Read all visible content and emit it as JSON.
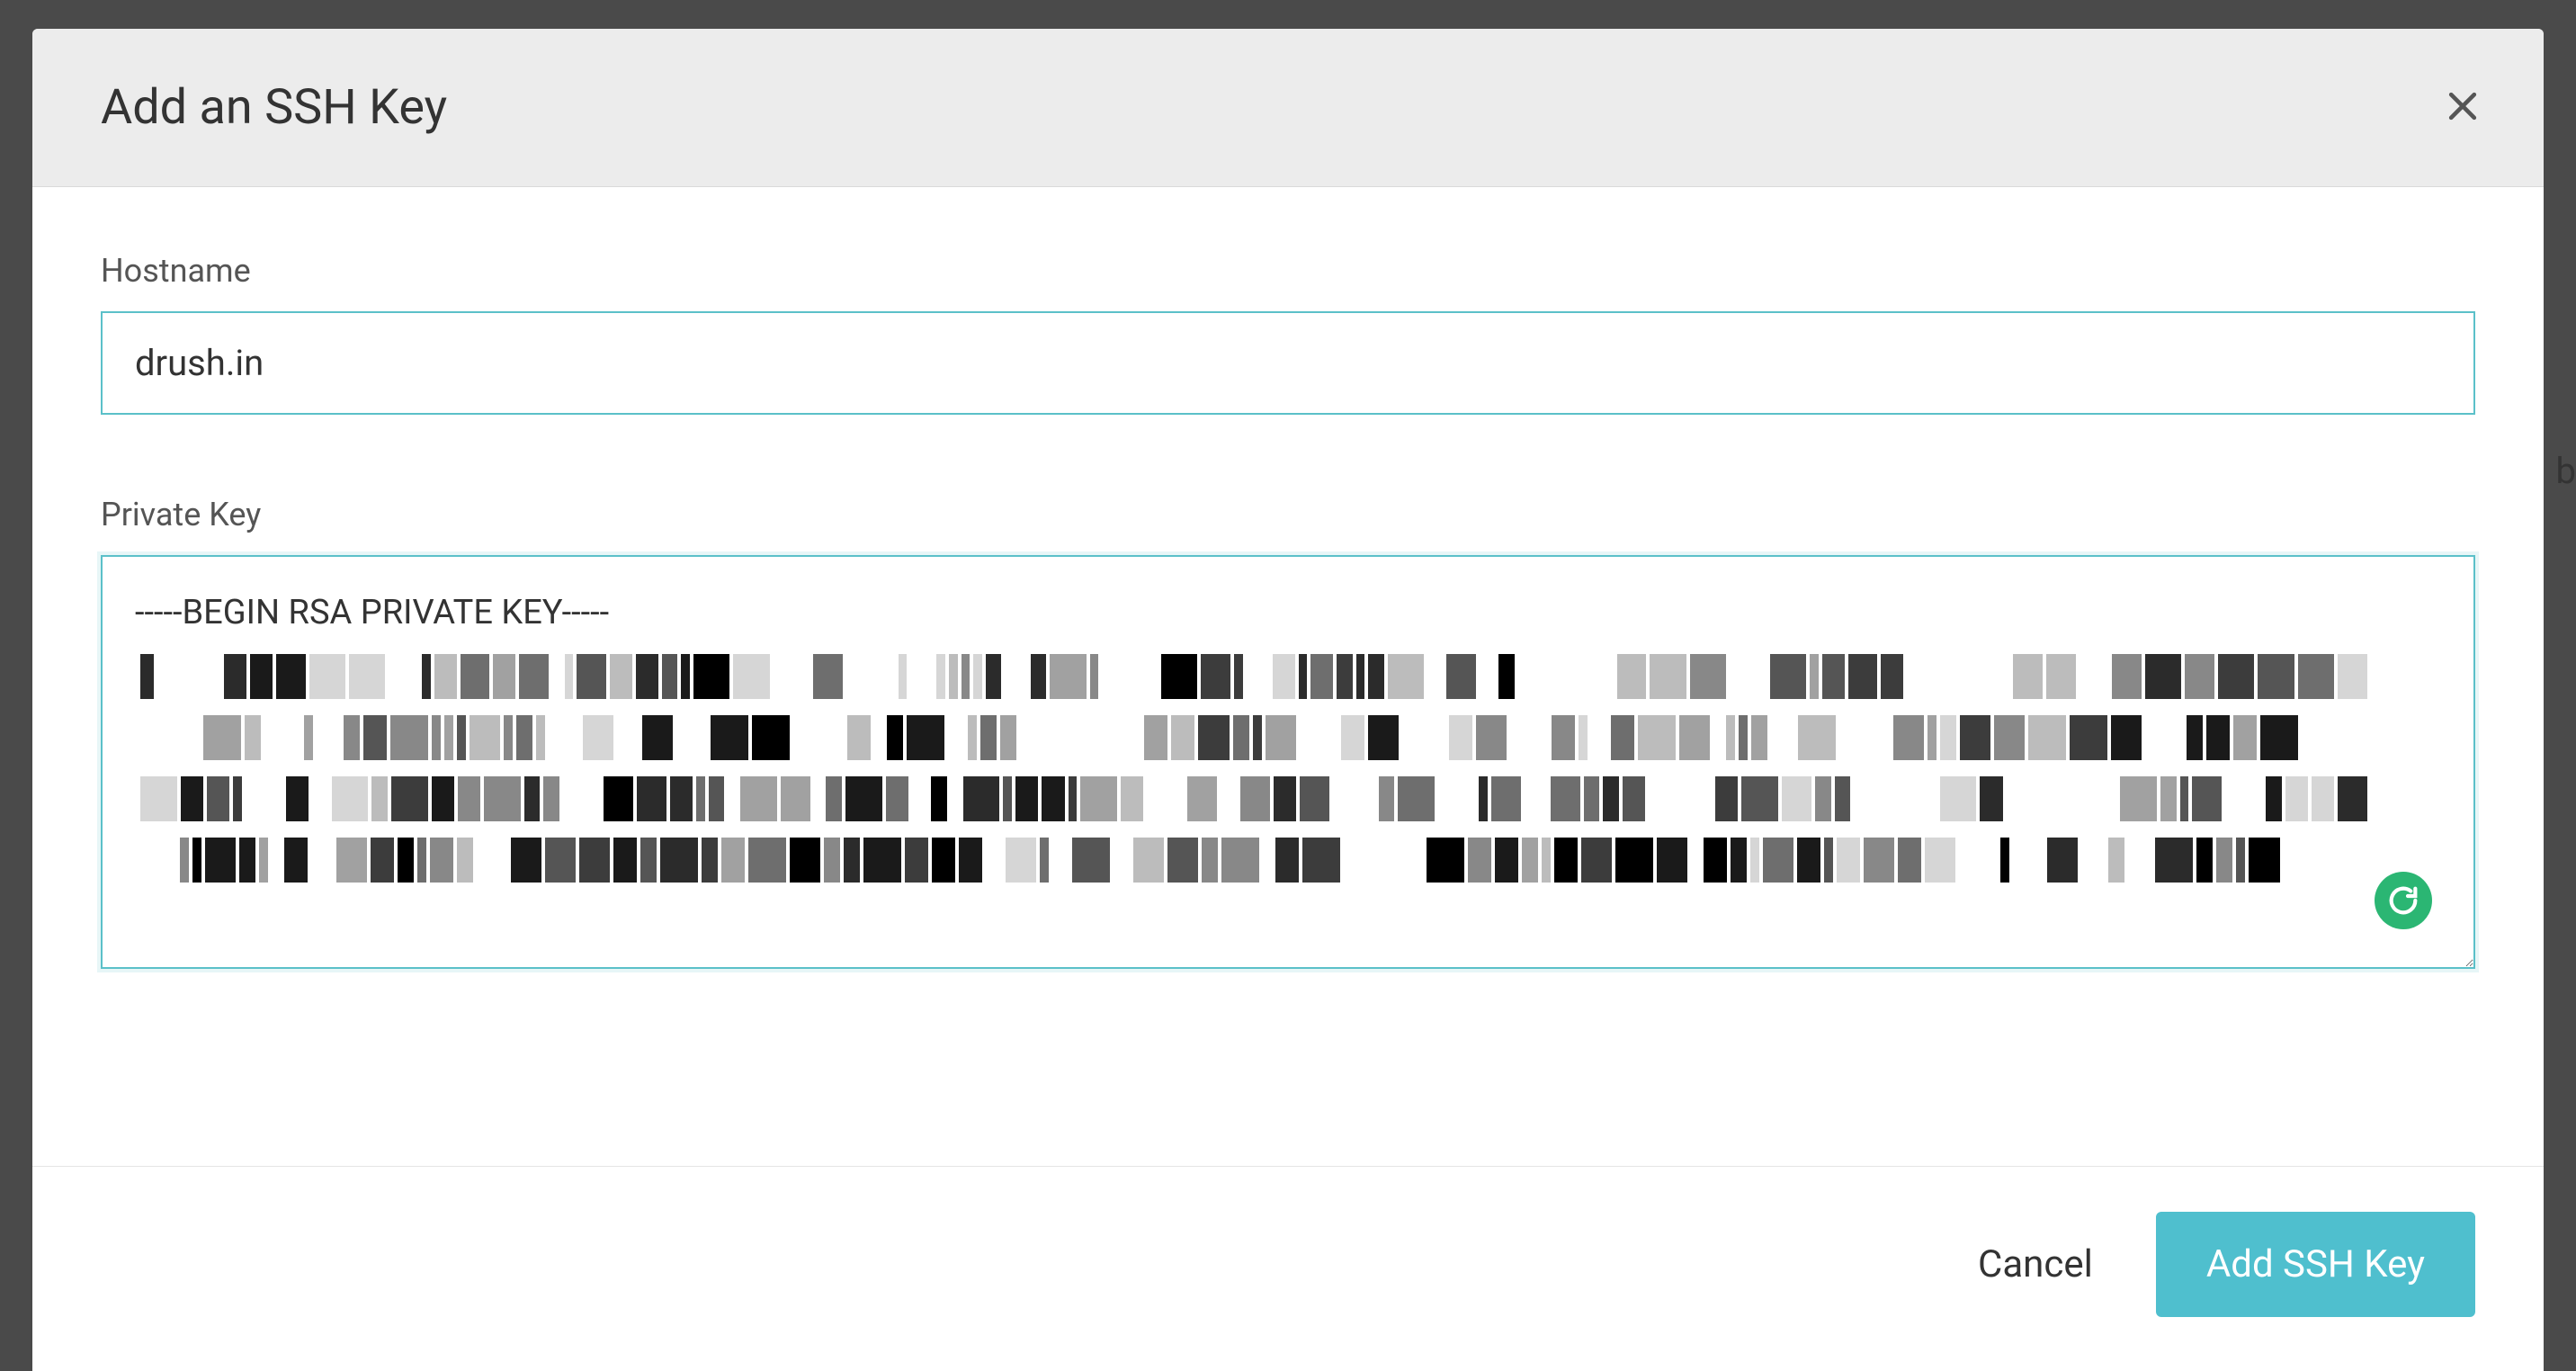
{
  "modal": {
    "title": "Add an SSH Key",
    "fields": {
      "hostname": {
        "label": "Hostname",
        "value": "drush.in"
      },
      "private_key": {
        "label": "Private Key",
        "value": "-----BEGIN RSA PRIVATE KEY-----"
      }
    },
    "buttons": {
      "cancel": "Cancel",
      "submit": "Add SSH Key"
    },
    "icons": {
      "close": "close-icon",
      "grammarly": "grammarly-icon"
    }
  }
}
